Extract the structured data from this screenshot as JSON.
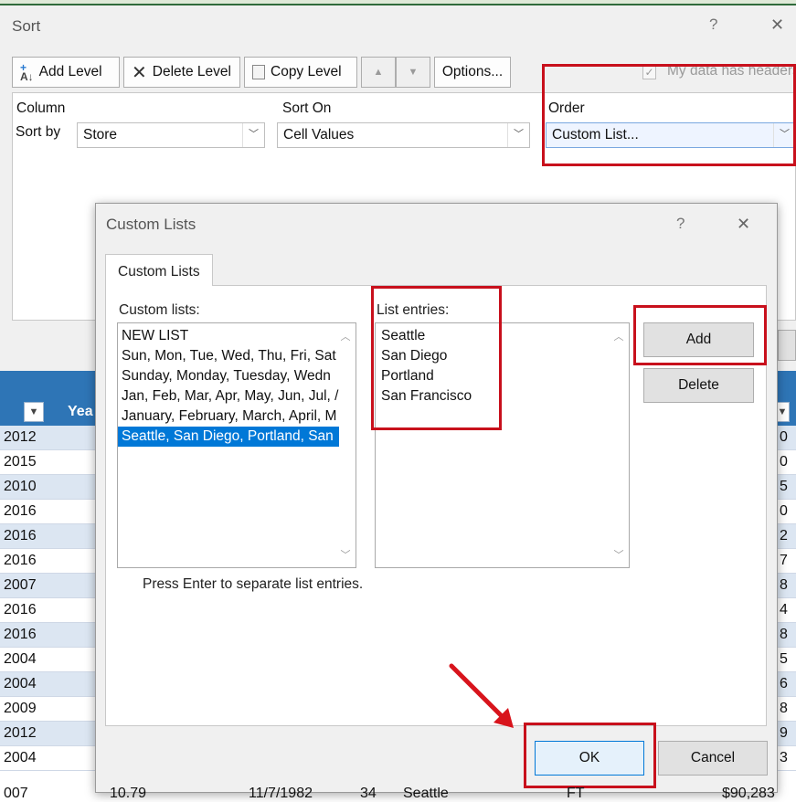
{
  "sort_dialog": {
    "title": "Sort",
    "help": "?",
    "close": "✕",
    "toolbar": {
      "add_level": "Add Level",
      "delete_level": "Delete Level",
      "copy_level": "Copy Level",
      "move_up": "▲",
      "move_down": "▼",
      "options": "Options...",
      "headers_checkbox_label": "My data has headers",
      "headers_checked": true
    },
    "columns": {
      "column": "Column",
      "sort_on": "Sort On",
      "order": "Order"
    },
    "row": {
      "label": "Sort by",
      "column_value": "Store",
      "sort_on_value": "Cell Values",
      "order_value": "Custom List..."
    }
  },
  "custom_lists_dialog": {
    "title": "Custom Lists",
    "help": "?",
    "close": "✕",
    "tab": "Custom Lists",
    "lists_label": "Custom lists:",
    "entries_label": "List entries:",
    "lists": [
      "NEW LIST",
      "Sun, Mon, Tue, Wed, Thu, Fri, Sat",
      "Sunday, Monday, Tuesday, Wedn",
      "Jan, Feb, Mar, Apr, May, Jun, Jul, /",
      "January, February, March, April, M",
      "Seattle, San Diego, Portland, San"
    ],
    "selected_list_index": 5,
    "entries": [
      "Seattle",
      "San Diego",
      "Portland",
      "San Francisco"
    ],
    "add_button": "Add",
    "delete_button": "Delete",
    "hint": "Press Enter to separate list entries.",
    "ok_button": "OK",
    "cancel_button": "Cancel"
  },
  "spreadsheet": {
    "header_partial": "Yea",
    "years": [
      "2012",
      "2015",
      "2010",
      "2016",
      "2016",
      "2016",
      "2007",
      "2016",
      "2016",
      "2004",
      "2004",
      "2009",
      "2012",
      "2004",
      "2007"
    ],
    "right_edge": [
      "0",
      "0",
      "5",
      "0",
      "2",
      "7",
      "8",
      "4",
      "8",
      "5",
      "6",
      "8",
      "9",
      "3"
    ],
    "last_row": {
      "year": "007",
      "col2": "10.79",
      "col3": "11/7/1982",
      "col4": "34",
      "col5": "Seattle",
      "col6": "FT",
      "col7": "$90,283"
    }
  },
  "colors": {
    "accent": "#0078d7",
    "annotation_red": "#c8101c",
    "table_header": "#2e75b6"
  }
}
